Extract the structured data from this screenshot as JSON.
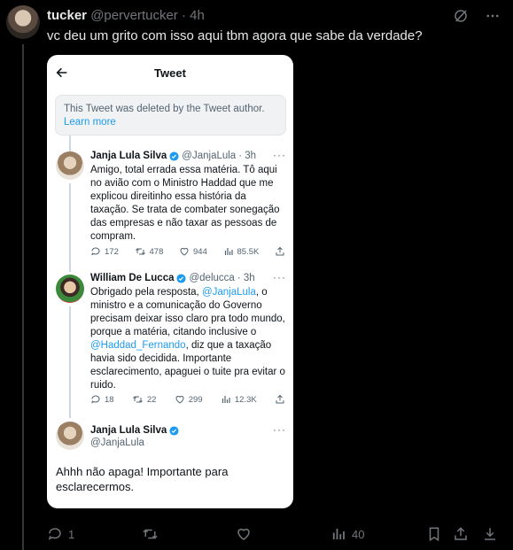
{
  "tweet": {
    "display_name": "tucker",
    "handle": "@pervertucker",
    "separator": "·",
    "time": "4h",
    "text": "vc deu um grito com isso aqui tbm agora que sabe da verdade?",
    "replies": "1",
    "views": "40"
  },
  "card": {
    "title": "Tweet",
    "deleted_text": "This Tweet was deleted by the Tweet author.",
    "learn_more": "Learn more",
    "replies": [
      {
        "name": "Janja Lula Silva",
        "handle": "@JanjaLula",
        "time": "· 3h",
        "text": "Amigo, total errada essa matéria. Tô aqui no avião com o Ministro Haddad que me explicou direitinho essa história da taxação. Se trata de combater sonegação das empresas e não taxar as pessoas de compram.",
        "stats": {
          "replies": "172",
          "retweets": "478",
          "likes": "944",
          "views": "85.5K"
        }
      },
      {
        "name": "William De Lucca",
        "handle": "@delucca",
        "time": "· 3h",
        "text_1": "Obrigado pela resposta, ",
        "mention_1": "@JanjaLula",
        "text_2": ", o ministro e a comunicação do Governo precisam deixar isso claro pra todo mundo, porque a matéria, citando inclusive o ",
        "mention_2": "@Haddad_Fernando",
        "text_3": ", diz que a taxação havia sido decidida. Importante esclarecimento, apaguei o tuite pra evitar o ruido.",
        "stats": {
          "replies": "18",
          "retweets": "22",
          "likes": "299",
          "views": "12.3K"
        }
      },
      {
        "name": "Janja Lula Silva",
        "handle": "@JanjaLula",
        "text": "Ahhh não apaga! Importante para esclarecermos."
      }
    ]
  },
  "colors": {
    "accent": "#1d9bf0",
    "background": "#000000",
    "muted": "#71767b"
  }
}
